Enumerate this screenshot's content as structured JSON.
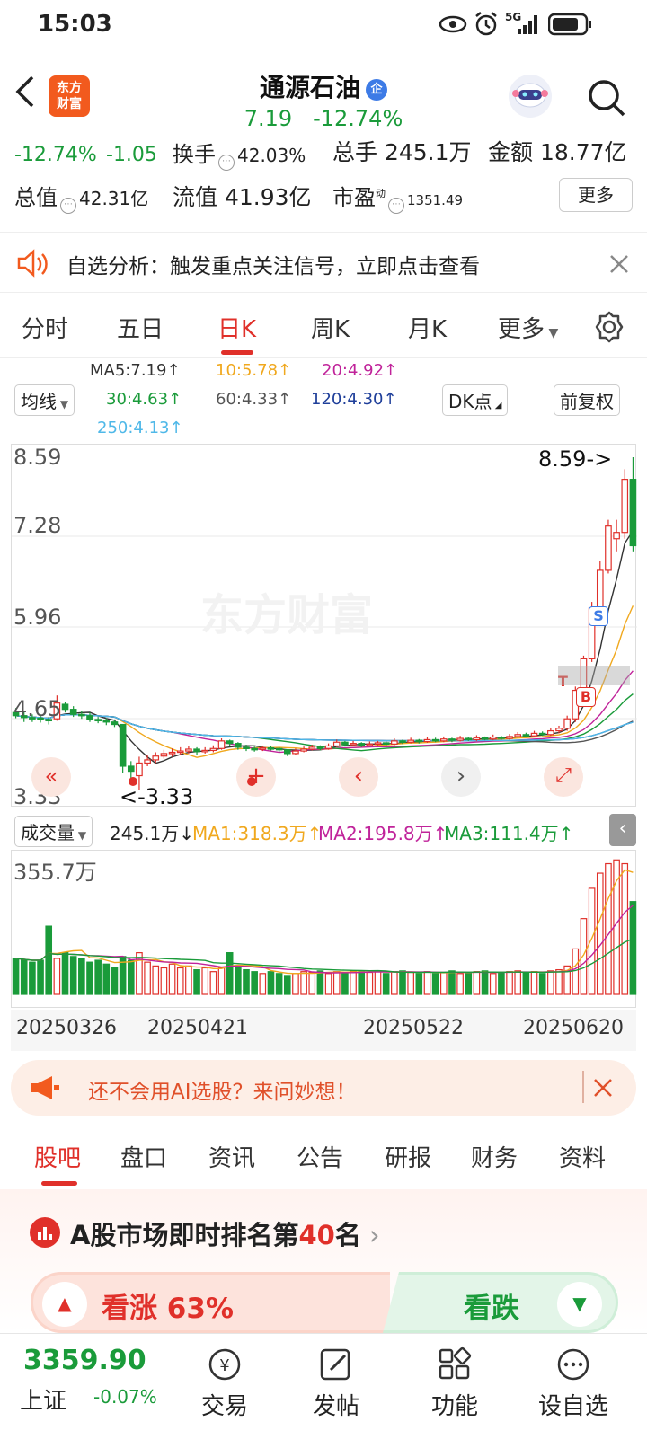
{
  "status": {
    "time": "15:03",
    "network": "5G"
  },
  "header": {
    "logo_line1": "东方",
    "logo_line2": "财富",
    "stock_name": "通源石油",
    "stock_badge": "企",
    "price": "7.19",
    "change_pct": "-12.74%"
  },
  "quote": {
    "pct": "-12.74%",
    "chg": "-1.05",
    "turnover_label": "换手",
    "turnover": "42.03%",
    "volume_label": "总手",
    "volume": "245.1万",
    "amount_label": "金额",
    "amount": "18.77亿",
    "mcap_label": "总值",
    "mcap": "42.31亿",
    "float_label": "流值",
    "float": "41.93亿",
    "pe_label": "市盈",
    "pe_sup": "动",
    "pe": "1351.49",
    "more": "更多"
  },
  "banner": {
    "text": "自选分析：触发重点关注信号，立即点击查看"
  },
  "tabs": [
    "分时",
    "五日",
    "日K",
    "周K",
    "月K",
    "更多"
  ],
  "ma_panel": {
    "selector": "均线",
    "ma5": "MA5:7.19↑",
    "ma10": "10:5.78↑",
    "ma20": "20:4.92↑",
    "ma30": "30:4.63↑",
    "ma60": "60:4.33↑",
    "ma120": "120:4.30↑",
    "ma250": "250:4.13↑",
    "dk": "DK点",
    "fq": "前复权"
  },
  "kchart": {
    "y_labels": [
      "8.59",
      "7.28",
      "5.96",
      "4.65",
      "3.33"
    ],
    "high_label": "8.59->",
    "low_label": "<-3.33",
    "watermark": "东方财富",
    "marker_s": "S",
    "marker_b": "B",
    "marker_t": "T"
  },
  "volume_panel": {
    "selector": "成交量",
    "current": "245.1万↓",
    "ma1": "MA1:318.3万↑",
    "ma2": "MA2:195.8万↑",
    "ma3": "MA3:111.4万↑",
    "ymax": "355.7万",
    "dates": [
      "20250326",
      "20250421",
      "20250522",
      "20250620"
    ]
  },
  "ad": {
    "text": "还不会用AI选股？来问妙想！"
  },
  "bottom_tabs": [
    "股吧",
    "盘口",
    "资讯",
    "公告",
    "研报",
    "财务",
    "资料"
  ],
  "rank": {
    "text_pre": "A股市场即时排名第",
    "rank": "40",
    "text_post": "名",
    "bull_label": "看涨 63%",
    "bear_label": "看跌"
  },
  "footer": {
    "index_value": "3359.90",
    "index_name": "上证",
    "index_change": "-0.07%",
    "items": [
      "交易",
      "发帖",
      "功能",
      "设自选"
    ]
  },
  "colors": {
    "up": "#e0302a",
    "down": "#1a9b3a",
    "accent": "#f25a1e",
    "ma5": "#333333",
    "ma10": "#f0a81e",
    "ma20": "#c0239a",
    "ma30": "#1a9b3a",
    "ma60": "#555555",
    "ma120": "#1f3f9a",
    "ma250": "#4fb8e8"
  },
  "chart_data": {
    "type": "candlestick",
    "candles": [
      [
        4.55,
        4.5,
        4.62,
        4.46
      ],
      [
        4.5,
        4.47,
        4.56,
        4.4
      ],
      [
        4.47,
        4.46,
        4.52,
        4.4
      ],
      [
        4.46,
        4.44,
        4.52,
        4.39
      ],
      [
        4.44,
        4.42,
        4.48,
        4.36
      ],
      [
        4.45,
        4.7,
        4.82,
        4.42
      ],
      [
        4.68,
        4.6,
        4.72,
        4.55
      ],
      [
        4.6,
        4.52,
        4.65,
        4.48
      ],
      [
        4.52,
        4.5,
        4.58,
        4.45
      ],
      [
        4.5,
        4.44,
        4.55,
        4.4
      ],
      [
        4.44,
        4.42,
        4.48,
        4.38
      ],
      [
        4.42,
        4.4,
        4.46,
        4.35
      ],
      [
        4.4,
        4.36,
        4.44,
        4.32
      ],
      [
        4.36,
        3.7,
        4.36,
        3.6
      ],
      [
        3.7,
        3.62,
        3.78,
        3.5
      ],
      [
        3.55,
        3.75,
        3.85,
        3.33
      ],
      [
        3.75,
        3.8,
        3.88,
        3.7
      ],
      [
        3.8,
        3.86,
        3.92,
        3.75
      ],
      [
        3.86,
        3.9,
        3.96,
        3.82
      ],
      [
        3.9,
        3.92,
        3.98,
        3.85
      ],
      [
        3.92,
        3.94,
        4.0,
        3.88
      ],
      [
        3.94,
        3.97,
        4.02,
        3.9
      ],
      [
        3.97,
        3.93,
        4.0,
        3.88
      ],
      [
        3.93,
        3.95,
        4.0,
        3.9
      ],
      [
        3.95,
        3.98,
        4.03,
        3.92
      ],
      [
        3.98,
        4.1,
        4.14,
        3.96
      ],
      [
        4.1,
        4.06,
        4.12,
        4.02
      ],
      [
        4.06,
        4.0,
        4.08,
        3.96
      ],
      [
        4.0,
        3.98,
        4.04,
        3.94
      ],
      [
        3.98,
        3.97,
        4.01,
        3.93
      ],
      [
        3.97,
        3.99,
        4.02,
        3.94
      ],
      [
        3.99,
        3.98,
        4.02,
        3.95
      ],
      [
        3.98,
        3.96,
        4.0,
        3.92
      ],
      [
        3.96,
        3.9,
        3.97,
        3.86
      ],
      [
        3.9,
        3.94,
        3.98,
        3.88
      ],
      [
        3.94,
        3.97,
        4.01,
        3.92
      ],
      [
        3.97,
        4.0,
        4.04,
        3.95
      ],
      [
        4.0,
        3.98,
        4.03,
        3.95
      ],
      [
        3.98,
        4.02,
        4.06,
        3.96
      ],
      [
        4.02,
        4.08,
        4.12,
        4.0
      ],
      [
        4.08,
        4.04,
        4.1,
        4.01
      ],
      [
        4.04,
        4.06,
        4.1,
        4.02
      ],
      [
        4.06,
        4.03,
        4.08,
        4.0
      ],
      [
        4.03,
        4.05,
        4.09,
        4.01
      ],
      [
        4.05,
        4.07,
        4.1,
        4.03
      ],
      [
        4.07,
        4.05,
        4.09,
        4.02
      ],
      [
        4.05,
        4.1,
        4.14,
        4.03
      ],
      [
        4.1,
        4.08,
        4.12,
        4.05
      ],
      [
        4.08,
        4.11,
        4.15,
        4.06
      ],
      [
        4.11,
        4.09,
        4.13,
        4.06
      ],
      [
        4.09,
        4.12,
        4.16,
        4.07
      ],
      [
        4.12,
        4.1,
        4.15,
        4.08
      ],
      [
        4.1,
        4.13,
        4.17,
        4.08
      ],
      [
        4.13,
        4.11,
        4.15,
        4.08
      ],
      [
        4.11,
        4.14,
        4.18,
        4.09
      ],
      [
        4.14,
        4.12,
        4.16,
        4.1
      ],
      [
        4.12,
        4.15,
        4.19,
        4.1
      ],
      [
        4.15,
        4.13,
        4.17,
        4.11
      ],
      [
        4.13,
        4.16,
        4.2,
        4.11
      ],
      [
        4.16,
        4.14,
        4.18,
        4.12
      ],
      [
        4.14,
        4.17,
        4.21,
        4.12
      ],
      [
        4.17,
        4.2,
        4.24,
        4.15
      ],
      [
        4.2,
        4.18,
        4.23,
        4.16
      ],
      [
        4.18,
        4.22,
        4.26,
        4.16
      ],
      [
        4.22,
        4.2,
        4.25,
        4.18
      ],
      [
        4.2,
        4.26,
        4.3,
        4.18
      ],
      [
        4.26,
        4.3,
        4.34,
        4.22
      ],
      [
        4.3,
        4.45,
        4.5,
        4.26
      ],
      [
        4.45,
        4.9,
        4.96,
        4.4
      ],
      [
        4.9,
        5.4,
        5.45,
        4.85
      ],
      [
        5.4,
        6.2,
        6.3,
        5.35
      ],
      [
        6.2,
        6.8,
        6.95,
        6.1
      ],
      [
        6.8,
        7.5,
        7.6,
        6.75
      ],
      [
        7.3,
        7.4,
        7.6,
        7.1
      ],
      [
        7.4,
        8.24,
        8.4,
        7.3
      ],
      [
        8.24,
        7.19,
        8.59,
        7.1
      ]
    ],
    "volumes": [
      95,
      90,
      85,
      90,
      180,
      95,
      110,
      100,
      95,
      85,
      90,
      80,
      70,
      100,
      90,
      110,
      85,
      75,
      70,
      80,
      70,
      75,
      65,
      70,
      60,
      70,
      110,
      75,
      65,
      60,
      55,
      60,
      55,
      50,
      55,
      60,
      58,
      62,
      55,
      60,
      58,
      62,
      60,
      58,
      62,
      55,
      60,
      62,
      58,
      55,
      60,
      55,
      58,
      62,
      55,
      58,
      60,
      62,
      55,
      58,
      60,
      62,
      58,
      60,
      55,
      62,
      65,
      75,
      120,
      200,
      280,
      320,
      345,
      355,
      345,
      245
    ]
  }
}
